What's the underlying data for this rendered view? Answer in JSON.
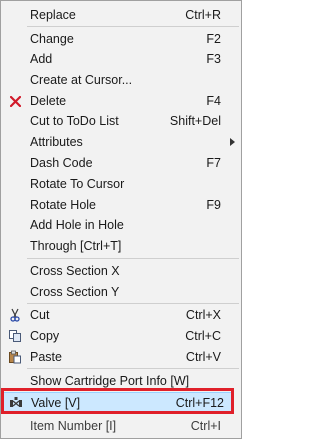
{
  "menu": {
    "items": [
      {
        "label": "Replace",
        "shortcut": "Ctrl+R"
      },
      {
        "label": "Change",
        "shortcut": "F2"
      },
      {
        "label": "Add",
        "shortcut": "F3"
      },
      {
        "label": "Create at Cursor...",
        "shortcut": ""
      },
      {
        "label": "Delete",
        "shortcut": "F4",
        "icon": "delete-x-icon"
      },
      {
        "label": "Cut to ToDo List",
        "shortcut": "Shift+Del"
      },
      {
        "label": "Attributes",
        "shortcut": ""
      },
      {
        "label": "Dash Code",
        "shortcut": "F7"
      },
      {
        "label": "Rotate To Cursor",
        "shortcut": ""
      },
      {
        "label": "Rotate Hole",
        "shortcut": "F9"
      },
      {
        "label": "Add Hole in Hole",
        "shortcut": ""
      },
      {
        "label": "Through  [Ctrl+T]",
        "shortcut": ""
      },
      {
        "label": "Cross Section X",
        "shortcut": ""
      },
      {
        "label": "Cross Section Y",
        "shortcut": ""
      },
      {
        "label": "Cut",
        "shortcut": "Ctrl+X",
        "icon": "scissors-icon"
      },
      {
        "label": "Copy",
        "shortcut": "Ctrl+C",
        "icon": "copy-icon"
      },
      {
        "label": "Paste",
        "shortcut": "Ctrl+V",
        "icon": "paste-icon"
      },
      {
        "label": "Show Cartridge Port Info  [W]",
        "shortcut": ""
      },
      {
        "label": "Valve  [V]",
        "shortcut": "Ctrl+F12",
        "icon": "valve-icon"
      },
      {
        "label": "Item Number  [I]",
        "shortcut": "Ctrl+I"
      }
    ]
  },
  "colors": {
    "menu_bg": "#f2f2f2",
    "highlight_bg": "#cce8ff",
    "highlight_border": "#99d1ff",
    "annotation_red": "#e0202a",
    "delete_icon": "#d11a2a"
  }
}
